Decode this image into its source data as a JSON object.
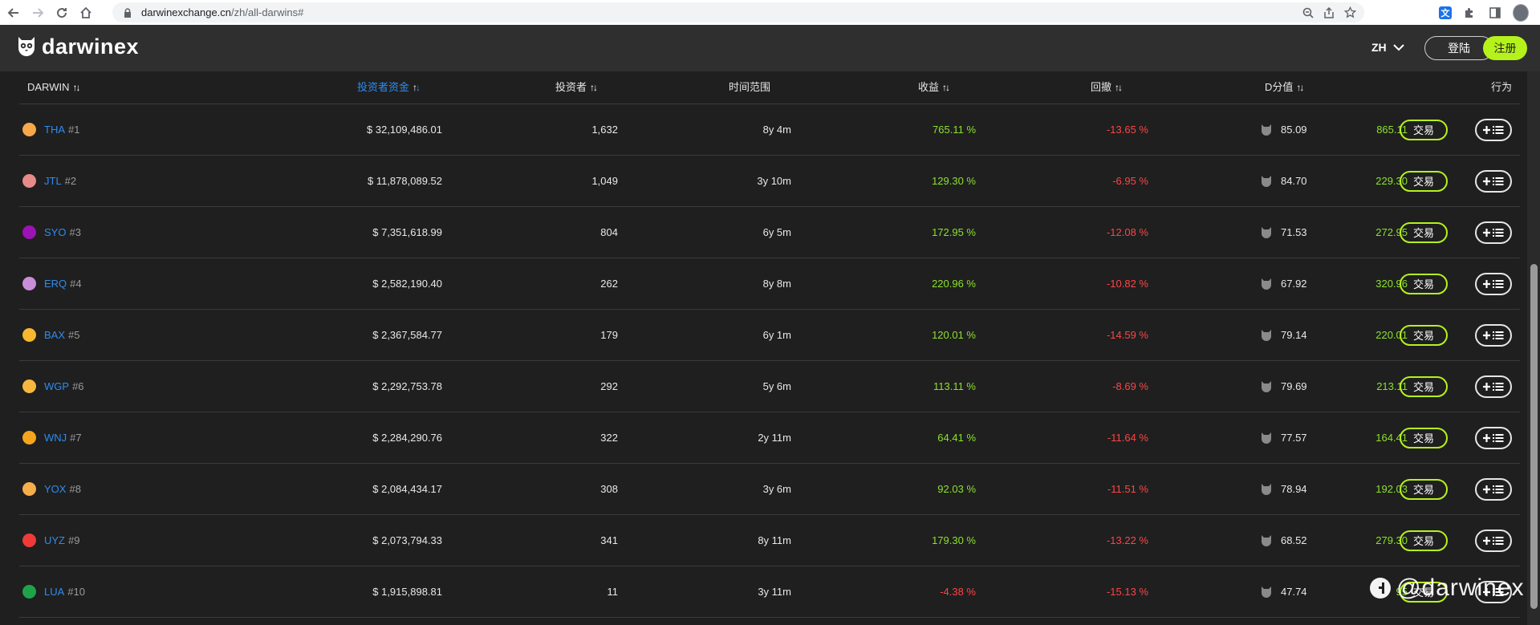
{
  "browser": {
    "url_domain": "darwinexchange.cn",
    "url_path": "/zh/all-darwins#"
  },
  "header": {
    "logo_text": "darwinex",
    "language": "ZH",
    "login_label": "登陆",
    "register_label": "注册",
    "brand_color": "#b5f21c"
  },
  "table": {
    "columns": {
      "darwin": "DARWIN",
      "investor_capital": "投资者资金",
      "investors": "投资者",
      "time_range": "时间范围",
      "return": "收益",
      "drawdown": "回撤",
      "d_score": "D分值",
      "actions": "行为"
    },
    "trade_label": "交易",
    "rows": [
      {
        "ticker": "THA",
        "rank": "#1",
        "dot_color": "#f6a84a",
        "capital": "$ 32,109,486.01",
        "investors": "1,632",
        "time": "8y 4m",
        "return": "765.11 %",
        "drawdown": "-13.65 %",
        "dscore": "85.09",
        "price": "865.11"
      },
      {
        "ticker": "JTL",
        "rank": "#2",
        "dot_color": "#e68a8a",
        "capital": "$ 11,878,089.52",
        "investors": "1,049",
        "time": "3y 10m",
        "return": "129.30 %",
        "drawdown": "-6.95 %",
        "dscore": "84.70",
        "price": "229.30"
      },
      {
        "ticker": "SYO",
        "rank": "#3",
        "dot_color": "#9b13b5",
        "capital": "$ 7,351,618.99",
        "investors": "804",
        "time": "6y 5m",
        "return": "172.95 %",
        "drawdown": "-12.08 %",
        "dscore": "71.53",
        "price": "272.95"
      },
      {
        "ticker": "ERQ",
        "rank": "#4",
        "dot_color": "#c88fd8",
        "capital": "$ 2,582,190.40",
        "investors": "262",
        "time": "8y 8m",
        "return": "220.96 %",
        "drawdown": "-10.82 %",
        "dscore": "67.92",
        "price": "320.96"
      },
      {
        "ticker": "BAX",
        "rank": "#5",
        "dot_color": "#f8b72e",
        "capital": "$ 2,367,584.77",
        "investors": "179",
        "time": "6y 1m",
        "return": "120.01 %",
        "drawdown": "-14.59 %",
        "dscore": "79.14",
        "price": "220.01"
      },
      {
        "ticker": "WGP",
        "rank": "#6",
        "dot_color": "#f7b73f",
        "capital": "$ 2,292,753.78",
        "investors": "292",
        "time": "5y 6m",
        "return": "113.11 %",
        "drawdown": "-8.69 %",
        "dscore": "79.69",
        "price": "213.11"
      },
      {
        "ticker": "WNJ",
        "rank": "#7",
        "dot_color": "#f5a51c",
        "capital": "$ 2,284,290.76",
        "investors": "322",
        "time": "2y 11m",
        "return": "64.41 %",
        "drawdown": "-11.64 %",
        "dscore": "77.57",
        "price": "164.41"
      },
      {
        "ticker": "YOX",
        "rank": "#8",
        "dot_color": "#f6ae4b",
        "capital": "$ 2,084,434.17",
        "investors": "308",
        "time": "3y 6m",
        "return": "92.03 %",
        "drawdown": "-11.51 %",
        "dscore": "78.94",
        "price": "192.03"
      },
      {
        "ticker": "UYZ",
        "rank": "#9",
        "dot_color": "#f03a3a",
        "capital": "$ 2,073,794.33",
        "investors": "341",
        "time": "8y 11m",
        "return": "179.30 %",
        "drawdown": "-13.22 %",
        "dscore": "68.52",
        "price": "279.30"
      },
      {
        "ticker": "LUA",
        "rank": "#10",
        "dot_color": "#1fa34a",
        "capital": "$ 1,915,898.81",
        "investors": "11",
        "time": "3y 11m",
        "return": "-4.38 %",
        "drawdown": "-15.13 %",
        "dscore": "47.74",
        "price": "95"
      }
    ]
  },
  "watermark": {
    "text": "@darwinex"
  }
}
